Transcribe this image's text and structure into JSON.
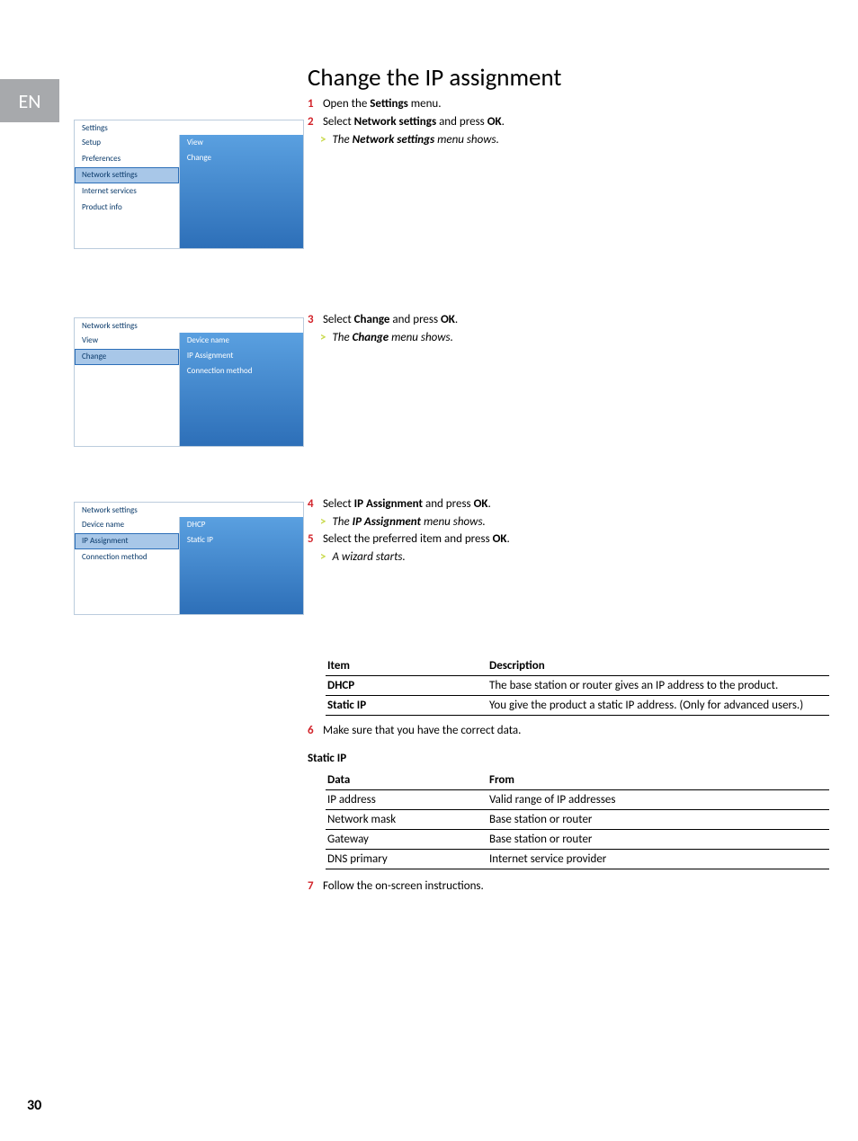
{
  "langTab": "EN",
  "pageNumber": "30",
  "heading": "Change the IP assignment",
  "steps": {
    "s1": {
      "num": "1",
      "text_a": "Open the ",
      "bold_a": "Settings",
      "text_b": " menu."
    },
    "s2": {
      "num": "2",
      "text_a": "Select ",
      "bold_a": "Network settings",
      "text_b": " and press ",
      "bold_b": "OK",
      "text_c": "."
    },
    "r2": {
      "chev": ">",
      "text_a": "The ",
      "bold_a": "Network settings",
      "text_b": " menu shows."
    },
    "s3": {
      "num": "3",
      "text_a": "Select ",
      "bold_a": "Change",
      "text_b": " and press ",
      "bold_b": "OK",
      "text_c": "."
    },
    "r3": {
      "chev": ">",
      "text_a": "The ",
      "bold_a": "Change",
      "text_b": " menu shows."
    },
    "s4": {
      "num": "4",
      "text_a": "Select ",
      "bold_a": "IP Assignment",
      "text_b": " and press ",
      "bold_b": "OK",
      "text_c": "."
    },
    "r4": {
      "chev": ">",
      "text_a": "The ",
      "bold_a": "IP Assignment",
      "text_b": " menu shows."
    },
    "s5": {
      "num": "5",
      "text_a": "Select the preferred item and press ",
      "bold_a": "OK",
      "text_b": "."
    },
    "r5": {
      "chev": ">",
      "text_a": "A wizard starts."
    },
    "s6": {
      "num": "6",
      "text_a": "Make sure that you have the correct data."
    },
    "s7": {
      "num": "7",
      "text_a": "Follow the on-screen instructions."
    }
  },
  "tbl1": {
    "h1": "Item",
    "h2": "Description",
    "rows": [
      {
        "c1": "DHCP",
        "c2": "The base station or router gives an IP address to the product."
      },
      {
        "c1": "Static IP",
        "c2": "You give the product a static IP address. (Only for advanced users.)"
      }
    ]
  },
  "staticIpHeading": "Static IP",
  "tbl2": {
    "h1": "Data",
    "h2": "From",
    "rows": [
      {
        "c1": "IP address",
        "c2": "Valid range of IP addresses"
      },
      {
        "c1": "Network mask",
        "c2": "Base station or router"
      },
      {
        "c1": "Gateway",
        "c2": "Base station or router"
      },
      {
        "c1": "DNS primary",
        "c2": "Internet service provider"
      }
    ]
  },
  "shot1": {
    "title": "Settings",
    "left": [
      "Setup",
      "Preferences",
      "Network settings",
      "Internet services",
      "Product info"
    ],
    "left_sel": 2,
    "right": [
      "View",
      "Change"
    ],
    "right_sel": -1
  },
  "shot2": {
    "title": "Network settings",
    "left": [
      "View",
      "Change"
    ],
    "left_sel": 1,
    "right": [
      "Device name",
      "IP Assignment",
      "Connection method"
    ],
    "right_sel": -1
  },
  "shot3": {
    "title": "Network settings",
    "left": [
      "Device name",
      "IP Assignment",
      "Connection method"
    ],
    "left_sel": 1,
    "right": [
      "DHCP",
      "Static IP"
    ],
    "right_sel": -1
  }
}
